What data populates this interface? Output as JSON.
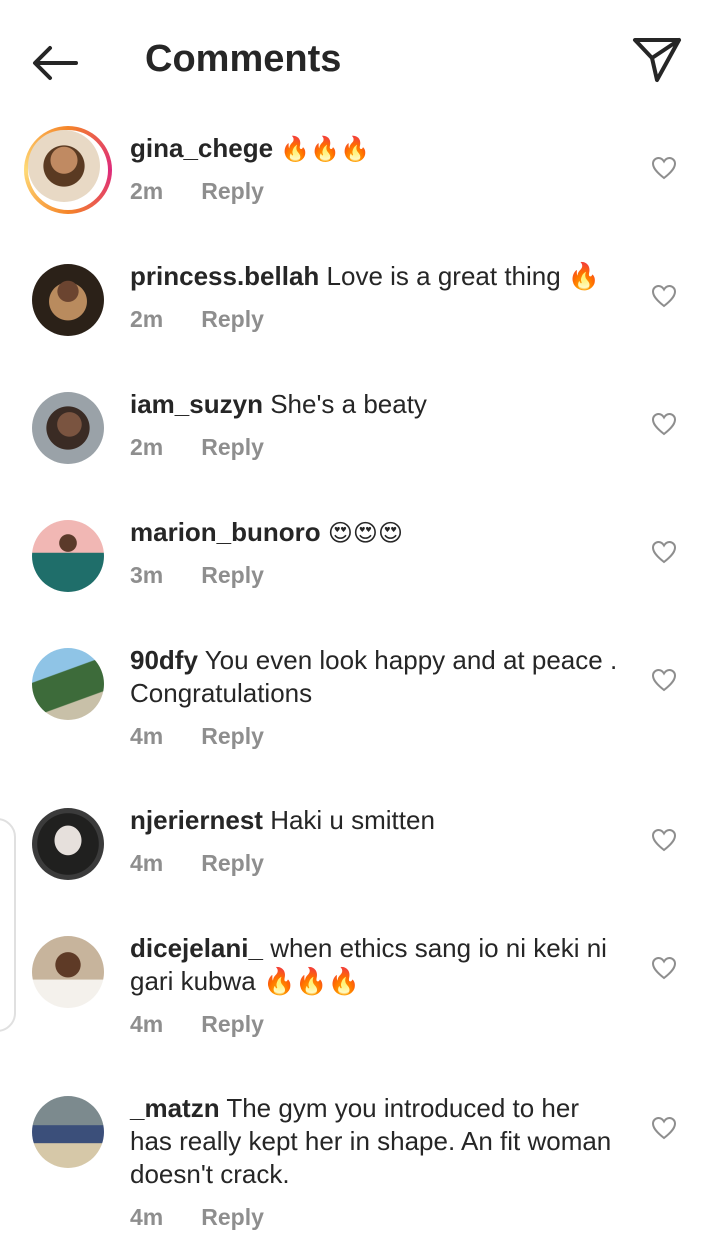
{
  "header": {
    "title": "Comments",
    "back_icon": "arrow-left-icon",
    "share_icon": "paper-plane-icon"
  },
  "comments": [
    {
      "user": "gina_chege",
      "text": "🔥🔥🔥",
      "time": "2m",
      "reply": "Reply"
    },
    {
      "user": "princess.bellah",
      "text": "Love is a great thing 🔥",
      "time": "2m",
      "reply": "Reply"
    },
    {
      "user": "iam_suzyn",
      "text": "She's a beaty",
      "time": "2m",
      "reply": "Reply"
    },
    {
      "user": "marion_bunoro",
      "text": "😍😍😍",
      "time": "3m",
      "reply": "Reply"
    },
    {
      "user": "90dfy",
      "text": "You even look happy and at peace . Congratulations",
      "time": "4m",
      "reply": "Reply"
    },
    {
      "user": "njeriernest",
      "text": "Haki u smitten",
      "time": "4m",
      "reply": "Reply"
    },
    {
      "user": "dicejelani_",
      "text": "when ethics sang io ni keki ni gari kubwa 🔥🔥🔥",
      "time": "4m",
      "reply": "Reply"
    },
    {
      "user": "_matzn",
      "text": "The gym you introduced to her has really kept her in shape. An fit woman doesn't crack.",
      "time": "4m",
      "reply": "Reply"
    }
  ],
  "colors": {
    "text": "#262626",
    "secondary": "#8e8e8e",
    "story_ring_start": "#f58529",
    "story_ring_end": "#dd2a7b"
  }
}
